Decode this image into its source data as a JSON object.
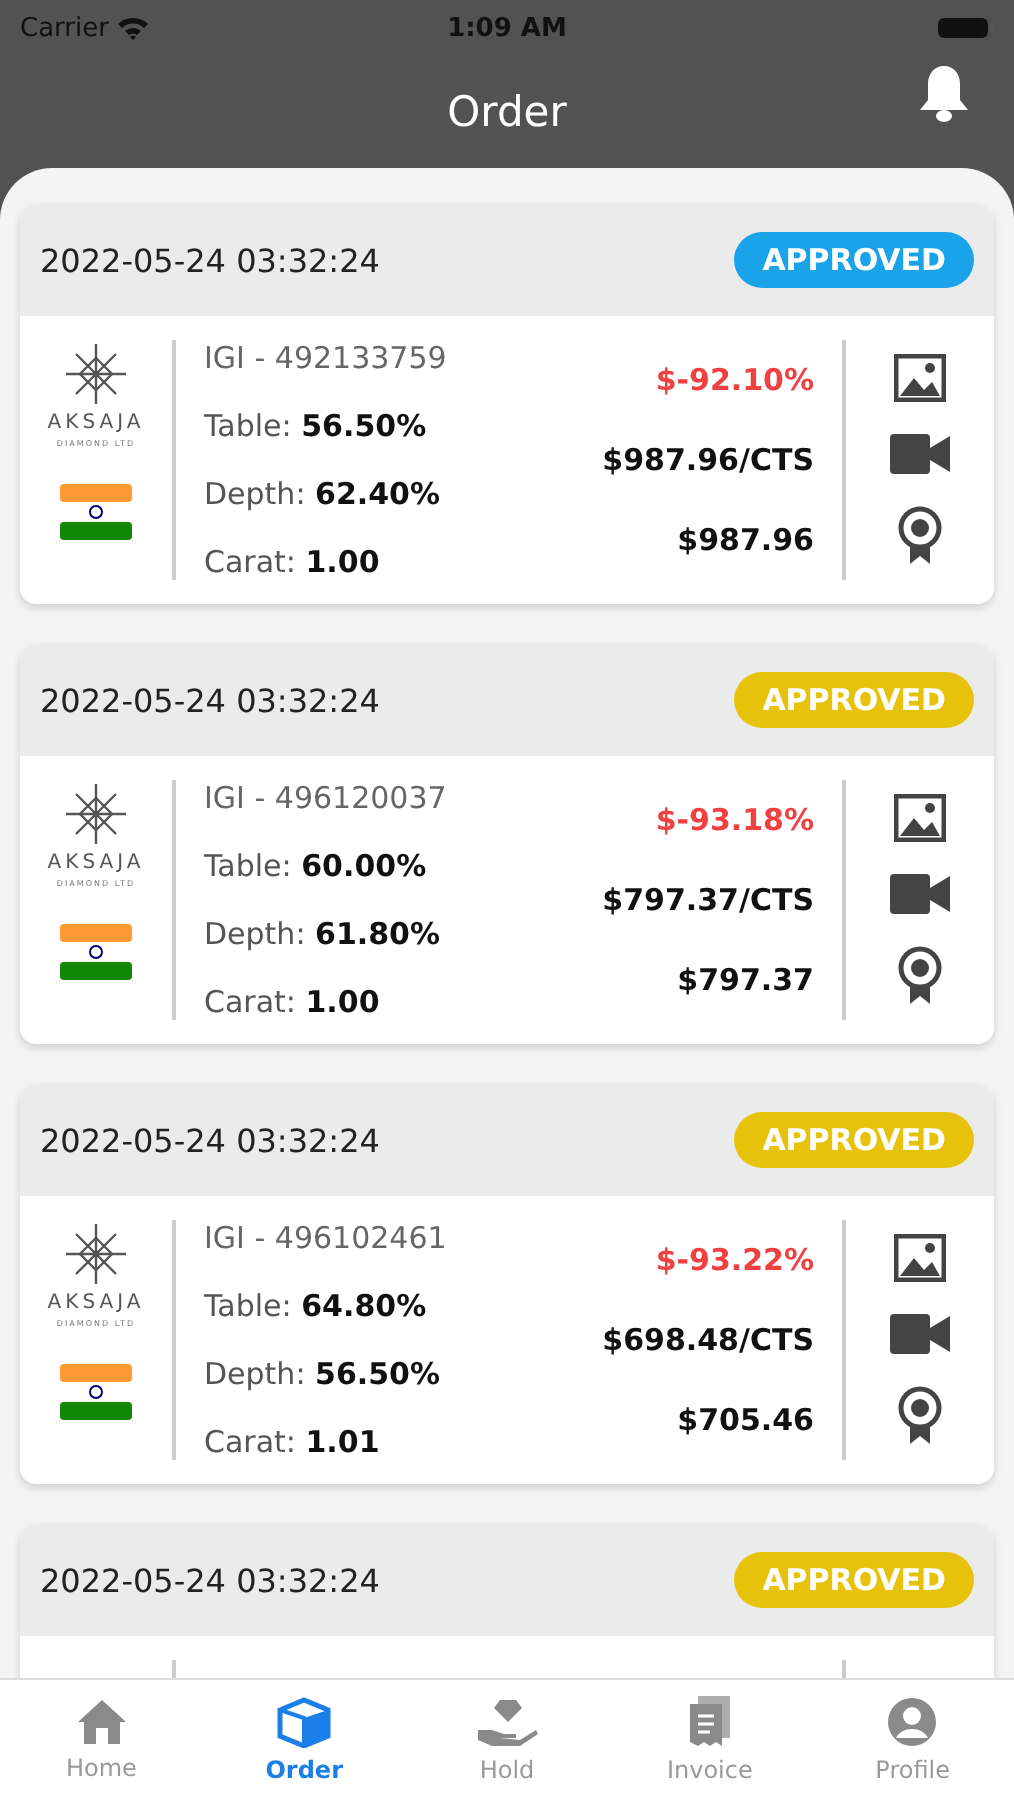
{
  "status_bar": {
    "carrier": "Carrier",
    "time": "1:09 AM"
  },
  "header": {
    "title": "Order"
  },
  "orders": [
    {
      "date": "2022-05-24 03:32:24",
      "status": "APPROVED",
      "color": "#1aa3e8",
      "logo_name": "AKSAJA",
      "logo_sub": "DIAMOND LTD",
      "igi": "IGI - 492133759",
      "table_label": "Table:",
      "table": "56.50%",
      "depth_label": "Depth:",
      "depth": "62.40%",
      "carat_label": "Carat:",
      "carat": "1.00",
      "discount": "$-92.10%",
      "per_carat": "$987.96/CTS",
      "total": "$987.96"
    },
    {
      "date": "2022-05-24 03:32:24",
      "status": "APPROVED",
      "color": "#e6c30a",
      "logo_name": "AKSAJA",
      "logo_sub": "DIAMOND LTD",
      "igi": "IGI - 496120037",
      "table_label": "Table:",
      "table": "60.00%",
      "depth_label": "Depth:",
      "depth": "61.80%",
      "carat_label": "Carat:",
      "carat": "1.00",
      "discount": "$-93.18%",
      "per_carat": "$797.37/CTS",
      "total": "$797.37"
    },
    {
      "date": "2022-05-24 03:32:24",
      "status": "APPROVED",
      "color": "#e6c30a",
      "logo_name": "AKSAJA",
      "logo_sub": "DIAMOND LTD",
      "igi": "IGI - 496102461",
      "table_label": "Table:",
      "table": "64.80%",
      "depth_label": "Depth:",
      "depth": "56.50%",
      "carat_label": "Carat:",
      "carat": "1.01",
      "discount": "$-93.22%",
      "per_carat": "$698.48/CTS",
      "total": "$705.46"
    },
    {
      "date": "2022-05-24 03:32:24",
      "status": "APPROVED",
      "color": "#e6c30a"
    }
  ],
  "tabs": [
    {
      "label": "Home",
      "kind": "home",
      "selected": false
    },
    {
      "label": "Order",
      "kind": "order",
      "selected": true
    },
    {
      "label": "Hold",
      "kind": "hold",
      "selected": false
    },
    {
      "label": "Invoice",
      "kind": "invoice",
      "selected": false
    },
    {
      "label": "Profile",
      "kind": "profile",
      "selected": false
    }
  ]
}
